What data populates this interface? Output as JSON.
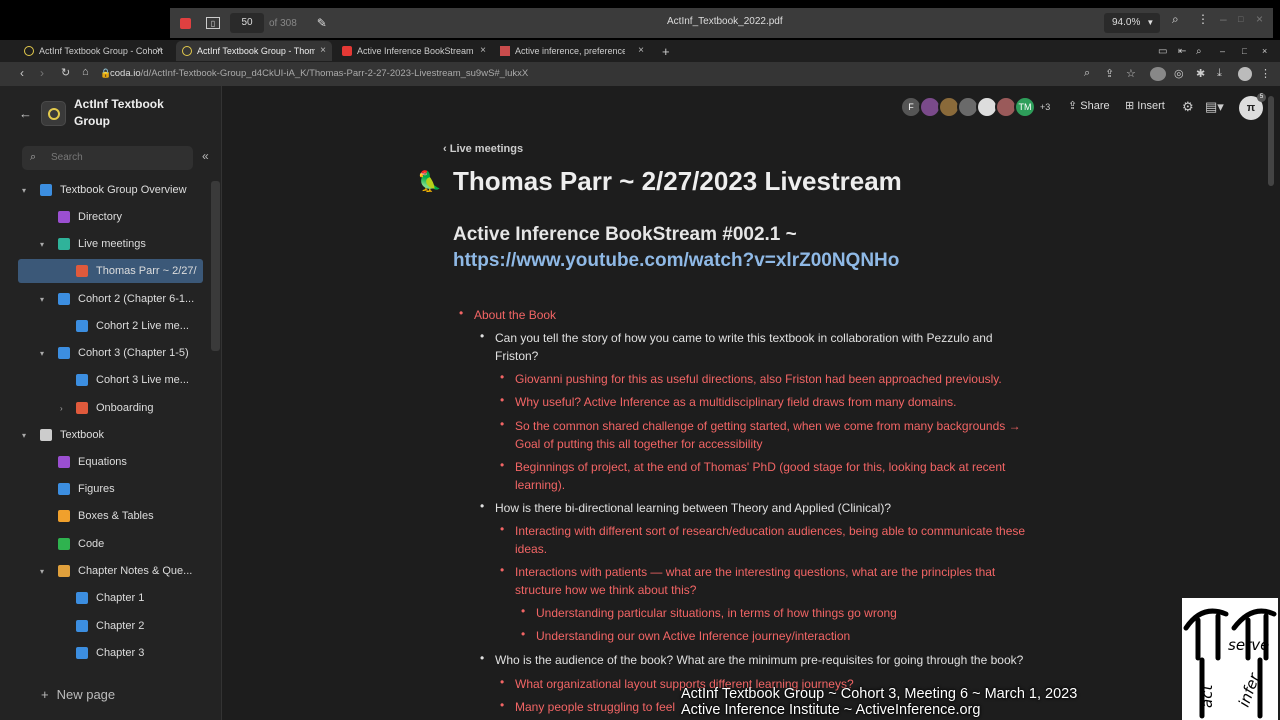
{
  "pdf_viewer": {
    "page_current": "50",
    "page_total": "of 308",
    "file_name": "ActInf_Textbook_2022.pdf",
    "zoom": "94.0%"
  },
  "tabs": [
    {
      "label": "ActInf Textbook Group - Cohort",
      "icon": "coda-icon"
    },
    {
      "label": "ActInf Textbook Group - Thomas",
      "icon": "coda-icon",
      "active": true
    },
    {
      "label": "Active Inference BookStream",
      "icon": "youtube-icon"
    },
    {
      "label": "Active inference, preference l",
      "icon": "paper-icon"
    }
  ],
  "address": {
    "domain": "coda.io",
    "path": "/d/ActInf-Textbook-Group_d4CkUI-iA_K/Thomas-Parr-2-27-2023-Livestream_su9wS#_lukxX"
  },
  "sidebar": {
    "doc_title": "ActInf Textbook Group",
    "search_placeholder": "Search",
    "items": [
      {
        "label": "Textbook Group Overview",
        "icon_color": "#3c8ee0"
      },
      {
        "label": "Directory",
        "icon_color": "#9b4fd1"
      },
      {
        "label": "Live meetings",
        "icon_color": "#2fb39a"
      },
      {
        "label": "Thomas Parr ~ 2/27/",
        "icon_color": "#e05a3c"
      },
      {
        "label": "Cohort 2 (Chapter 6-1...",
        "icon_color": "#3c8ee0"
      },
      {
        "label": "Cohort 2 Live me...",
        "icon_color": "#3c8ee0"
      },
      {
        "label": "Cohort 3 (Chapter 1-5)",
        "icon_color": "#3c8ee0"
      },
      {
        "label": "Cohort 3 Live me...",
        "icon_color": "#3c8ee0"
      },
      {
        "label": "Onboarding",
        "icon_color": "#e05a3c"
      },
      {
        "label": "Textbook",
        "icon_color": "#cccccc"
      },
      {
        "label": "Equations",
        "icon_color": "#9b4fd1"
      },
      {
        "label": "Figures",
        "icon_color": "#3c8ee0"
      },
      {
        "label": "Boxes & Tables",
        "icon_color": "#f0a02c"
      },
      {
        "label": "Code",
        "icon_color": "#2fb34f"
      },
      {
        "label": "Chapter Notes & Que...",
        "icon_color": "#e0a03c"
      },
      {
        "label": "Chapter 1",
        "icon_color": "#3c8ee0"
      },
      {
        "label": "Chapter 2",
        "icon_color": "#3c8ee0"
      },
      {
        "label": "Chapter 3",
        "icon_color": "#3c8ee0"
      }
    ],
    "new_page": "New page"
  },
  "header": {
    "avatars": [
      "F",
      "",
      "",
      "",
      "",
      "",
      "TM"
    ],
    "avatars_more": "+3",
    "share": "Share",
    "insert": "Insert",
    "profile_badge": "5"
  },
  "page": {
    "breadcrumb": "Live meetings",
    "title": "Thomas Parr ~ 2/27/2023 Livestream",
    "subtitle": "Active Inference BookStream #002.1 ~",
    "link": "https://www.youtube.com/watch?v=xlrZ00NQNHo",
    "outline": [
      {
        "level": 0,
        "color": "red",
        "text": "About the Book"
      },
      {
        "level": 1,
        "color": "white",
        "text": "Can you tell the story of how you came to write this textbook in collaboration with Pezzulo and Friston?"
      },
      {
        "level": 2,
        "color": "red",
        "text": "Giovanni pushing for this as useful directions, also Friston had been approached previously."
      },
      {
        "level": 2,
        "color": "red",
        "text": "Why useful? Active Inference as a multidisciplinary field draws from many domains."
      },
      {
        "level": 2,
        "color": "red",
        "text": "So the common shared challenge of getting started, when we come from many backgrounds → Goal of putting this all together for accessibility"
      },
      {
        "level": 2,
        "color": "red",
        "text": "Beginnings of project, at the end of Thomas' PhD (good stage for this, looking back at recent learning)."
      },
      {
        "level": 1,
        "color": "white",
        "text": "How is there bi-directional learning between Theory and Applied (Clinical)?"
      },
      {
        "level": 2,
        "color": "red",
        "text": "Interacting with different sort of research/education audiences, being able to communicate these ideas."
      },
      {
        "level": 2,
        "color": "red",
        "text": "Interactions with patients — what are the interesting questions, what are the principles that structure how we think about this?"
      },
      {
        "level": 3,
        "color": "red",
        "text": "Understanding particular situations, in terms of how things go wrong"
      },
      {
        "level": 3,
        "color": "red",
        "text": "Understanding our own Active Inference journey/interaction"
      },
      {
        "level": 1,
        "color": "white",
        "text": "Who is the audience of the book? What are the minimum pre-requisites for going through the book?"
      },
      {
        "level": 2,
        "color": "red",
        "text": "What organizational layout supports different learning journeys?"
      },
      {
        "level": 2,
        "color": "red",
        "text": "Many people struggling to feel"
      }
    ]
  },
  "overlay": {
    "caption_line1": "ActInf Textbook Group ~ Cohort 3, Meeting 6 ~ March 1, 2023",
    "caption_line2": "Active Inference Institute ~ ActiveInference.org",
    "logo_text_1": "serve",
    "logo_text_2": "act",
    "logo_text_3": "infer"
  }
}
